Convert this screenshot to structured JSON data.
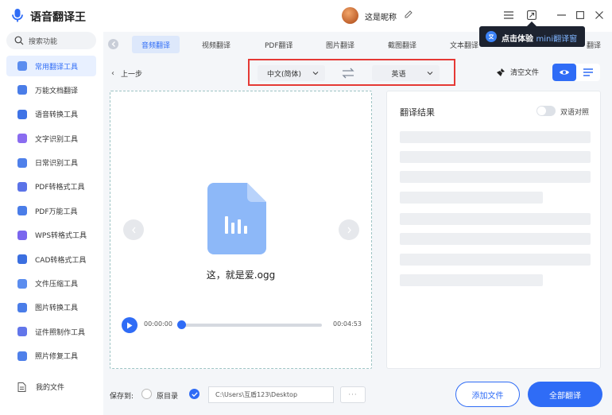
{
  "app": {
    "title": "语音翻译王",
    "nickname": "这是昵称"
  },
  "mini_tip": {
    "prefix": "点击体验",
    "highlight": "mini翻译窗"
  },
  "sidebar": {
    "search_placeholder": "搜索功能",
    "items": [
      {
        "label": "常用翻译工具",
        "icon": "translate-icon",
        "color": "#5b8def",
        "active": true
      },
      {
        "label": "万能文档翻译",
        "icon": "document-icon",
        "color": "#4a7de8"
      },
      {
        "label": "语音转换工具",
        "icon": "audio-convert-icon",
        "color": "#3f73e6"
      },
      {
        "label": "文字识别工具",
        "icon": "text-recognition-icon",
        "color": "#8a6cf0"
      },
      {
        "label": "日常识别工具",
        "icon": "scan-icon",
        "color": "#4f80ea"
      },
      {
        "label": "PDF转格式工具",
        "icon": "pdf-convert-icon",
        "color": "#5b73e8"
      },
      {
        "label": "PDF万能工具",
        "icon": "pdf-tools-icon",
        "color": "#4a7de8"
      },
      {
        "label": "WPS转格式工具",
        "icon": "wps-convert-icon",
        "color": "#7a66ee"
      },
      {
        "label": "CAD转格式工具",
        "icon": "cad-convert-icon",
        "color": "#3b6fe0"
      },
      {
        "label": "文件压缩工具",
        "icon": "compress-icon",
        "color": "#5b8def"
      },
      {
        "label": "图片转换工具",
        "icon": "image-convert-icon",
        "color": "#4a7de8"
      },
      {
        "label": "证件照制作工具",
        "icon": "id-photo-icon",
        "color": "#6276ea"
      },
      {
        "label": "照片修复工具",
        "icon": "photo-repair-icon",
        "color": "#4f80ea"
      }
    ],
    "my_files": "我的文件"
  },
  "tabs": [
    {
      "label": "音频翻译",
      "active": true
    },
    {
      "label": "视频翻译"
    },
    {
      "label": "PDF翻译"
    },
    {
      "label": "图片翻译"
    },
    {
      "label": "截图翻译"
    },
    {
      "label": "文本翻译"
    },
    {
      "label": "翻译"
    }
  ],
  "toolbar": {
    "back": "上一步",
    "source_lang": "中文(简体)",
    "target_lang": "英语",
    "clear": "清空文件"
  },
  "file": {
    "name": "这，就是爱.ogg",
    "current_time": "00:00:00",
    "duration": "00:04:53",
    "progress": 0
  },
  "result": {
    "title": "翻译结果",
    "bilingual_label": "双语对照",
    "bilingual_on": false
  },
  "bottom": {
    "save_to": "保存到:",
    "radio_original": "原目录",
    "path": "C:\\Users\\互盾123\\Desktop",
    "more": "···",
    "add_file": "添加文件",
    "translate_all": "全部翻译"
  },
  "colors": {
    "accent": "#2f6cf6",
    "highlight_box": "#e53935",
    "tip_bg": "#1d2330"
  }
}
